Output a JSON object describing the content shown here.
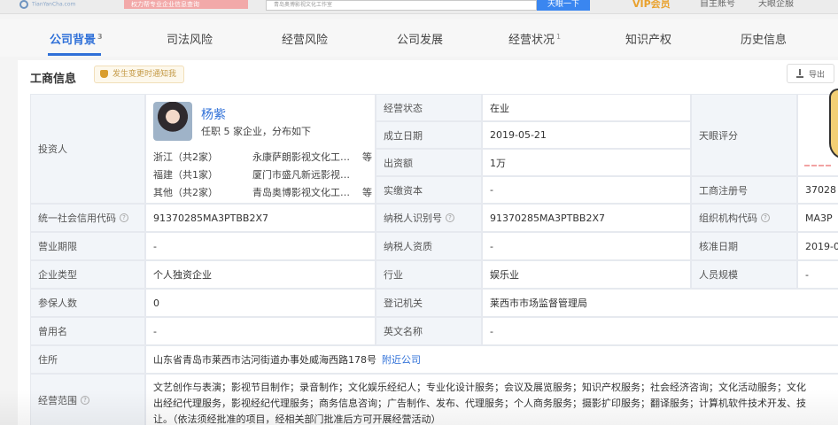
{
  "header": {
    "logo_text": "TianYanCha.com",
    "banner_text": "权力帮专业企业信息查询",
    "search_value": "青岛奥博影视文化工作室",
    "search_button": "天眼一下",
    "vip_label": "VIP会员",
    "links": [
      "自主账号",
      "天眼企服"
    ]
  },
  "tabs": [
    {
      "label": "公司背景",
      "count": "3"
    },
    {
      "label": "司法风险",
      "count": ""
    },
    {
      "label": "经营风险",
      "count": ""
    },
    {
      "label": "公司发展",
      "count": ""
    },
    {
      "label": "经营状况",
      "count": "1"
    },
    {
      "label": "知识产权",
      "count": ""
    },
    {
      "label": "历史信息",
      "count": ""
    }
  ],
  "section": {
    "title": "工商信息",
    "badge": "发生变更时通知我",
    "export": "导出"
  },
  "investor": {
    "label": "投资人",
    "name": "杨紫",
    "summary": "任职 5 家企业，分布如下",
    "rows": [
      {
        "province": "浙江（共2家）",
        "company": "永康萨朗影视文化工…",
        "etc": "等"
      },
      {
        "province": "福建（共1家）",
        "company": "厦门市盛凡新远影视…",
        "etc": ""
      },
      {
        "province": "其他（共2家）",
        "company": "青岛奥博影视文化工…",
        "etc": "等"
      }
    ]
  },
  "mid": {
    "status_label": "经营状态",
    "status_value": "在业",
    "found_label": "成立日期",
    "found_value": "2019-05-21",
    "capital_label": "出资额",
    "capital_value": "1万",
    "paid_label": "实缴资本",
    "paid_value": "-"
  },
  "right": {
    "tianyan_label": "天眼评分",
    "reg_label": "工商注册号",
    "reg_value": "37028",
    "org_label": "组织机构代码",
    "org_value": "MA3P",
    "approve_label": "核准日期",
    "approve_value": "2019-0",
    "staff_label": "人员规模",
    "staff_value": "-"
  },
  "rows": {
    "credit_label": "统一社会信用代码",
    "credit_value": "91370285MA3PTBB2X7",
    "tax_label": "纳税人识别号",
    "tax_value": "91370285MA3PTBB2X7",
    "term_label": "营业期限",
    "term_value": "-",
    "taxq_label": "纳税人资质",
    "taxq_value": "-",
    "type_label": "企业类型",
    "type_value": "个人独资企业",
    "industry_label": "行业",
    "industry_value": "娱乐业",
    "insured_label": "参保人数",
    "insured_value": "0",
    "authority_label": "登记机关",
    "authority_value": "莱西市市场监督管理局",
    "former_label": "曾用名",
    "former_value": "-",
    "english_label": "英文名称",
    "english_value": "-",
    "address_label": "住所",
    "address_value": "山东省青岛市莱西市沽河街道办事处威海西路178号",
    "address_link": "附近公司",
    "scope_label": "经营范围",
    "scope_line1": "文艺创作与表演；影视节目制作；录音制作；文化娱乐经纪人；专业化设计服务；会议及展览服务；知识产权服务；社会经济咨询；文化活动服务；文化",
    "scope_line2": "出经纪代理服务，影视经纪代理服务；商务信息咨询；广告制作、发布、代理服务；个人商务服务；摄影扩印服务；翻译服务；计算机软件技术开发、技",
    "scope_line3": "让。（依法须经批准的项目，经相关部门批准后方可开展经营活动）"
  }
}
